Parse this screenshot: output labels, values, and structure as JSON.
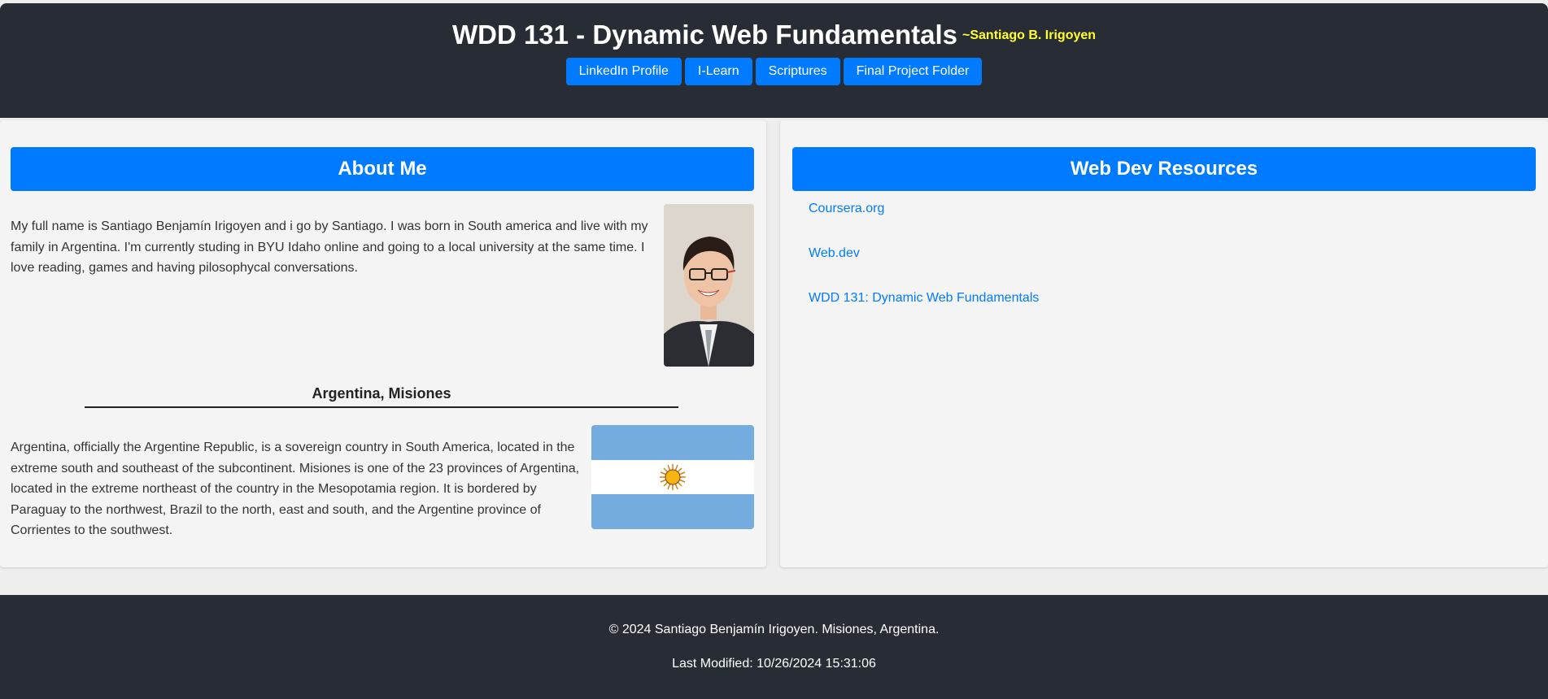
{
  "header": {
    "title": "WDD 131 - Dynamic Web Fundamentals",
    "author": "~Santiago B. Irigoyen",
    "nav": [
      "LinkedIn Profile",
      "I-Learn",
      "Scriptures",
      "Final Project Folder"
    ]
  },
  "about": {
    "heading": "About Me",
    "text": "My full name is Santiago Benjamín Irigoyen and i go by Santiago. I was born in South america and live with my family in Argentina. I'm currently studing in BYU Idaho online and going to a local university at the same time. I love reading, games and having pilosophycal conversations.",
    "location_heading": "Argentina, Misiones",
    "location_text": "Argentina, officially the Argentine Republic, is a sovereign country in South America, located in the extreme south and southeast of the subcontinent. Misiones is one of the 23 provinces of Argentina, located in the extreme northeast of the country in the Mesopotamia region. It is bordered by Paraguay to the northwest, Brazil to the north, east and south, and the Argentine province of Corrientes to the southwest."
  },
  "resources": {
    "heading": "Web Dev Resources",
    "links": [
      "Coursera.org",
      "Web.dev",
      "WDD 131: Dynamic Web Fundamentals"
    ]
  },
  "footer": {
    "copyright": "© 2024 Santiago Benjamín Irigoyen. Misiones, Argentina.",
    "last_modified": "Last Modified: 10/26/2024 15:31:06"
  },
  "colors": {
    "header_bg": "#282c34",
    "accent": "#007bff",
    "subtitle": "#ffff33",
    "card_bg": "#f4f4f4",
    "flag_blue": "#74acdf"
  },
  "icons": [
    "profile-photo",
    "argentina-flag"
  ]
}
